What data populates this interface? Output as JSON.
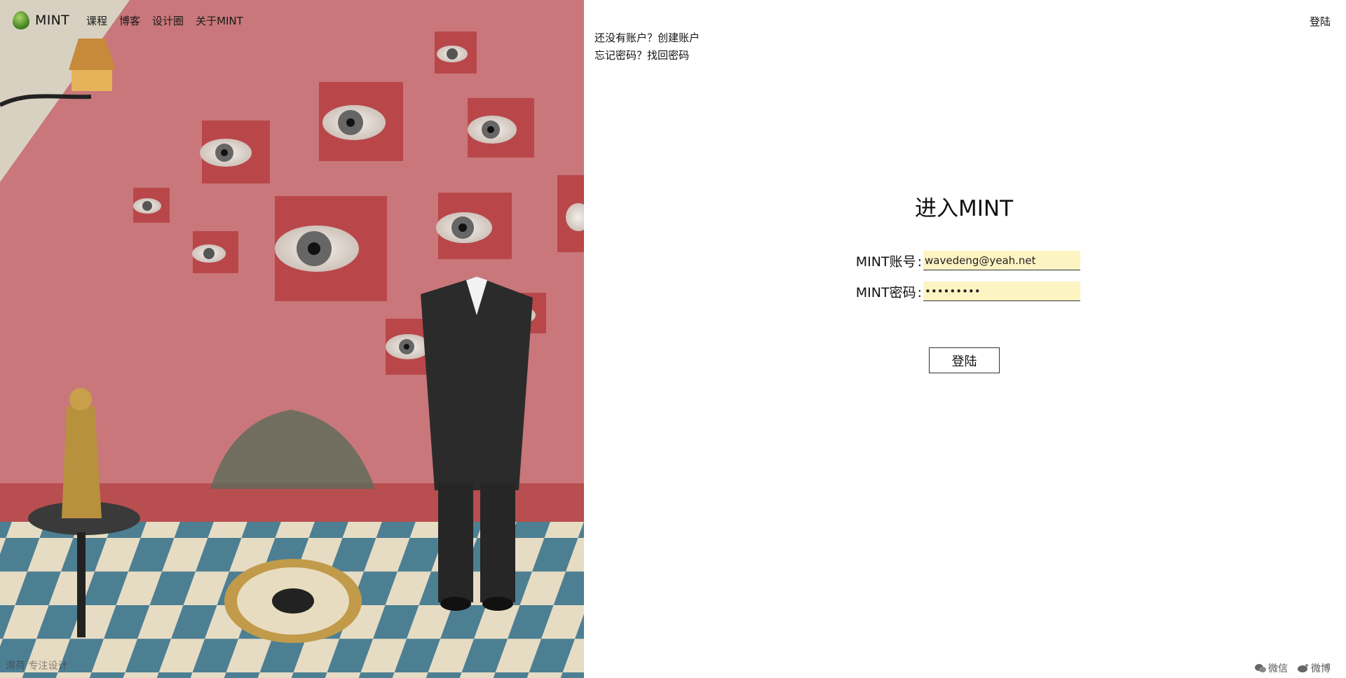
{
  "nav": {
    "brand": "MINT",
    "items": [
      "课程",
      "博客",
      "设计圈",
      "关于MINT"
    ]
  },
  "top_links": {
    "register_prompt": "还没有账户？创建账户",
    "forgot_prompt": "忘记密码？找回密码"
  },
  "header": {
    "login_link": "登陆"
  },
  "form": {
    "title": "进入MINT",
    "account_label": "MINT账号",
    "account_value": "wavedeng@yeah.net",
    "password_label": "MINT密码",
    "password_value": "•••••••••",
    "submit_label": "登陆"
  },
  "footer": {
    "left_text": "渭荷 专注设计",
    "share_wechat": "微信",
    "share_weibo": "微博",
    "wechat_icon": "wechat-icon",
    "weibo_icon": "weibo-icon"
  },
  "colors": {
    "wall": "#c9777a",
    "input_bg": "#fdf4c3",
    "tile_blue": "#4d7f93",
    "tile_cream": "#e6dcc4"
  }
}
